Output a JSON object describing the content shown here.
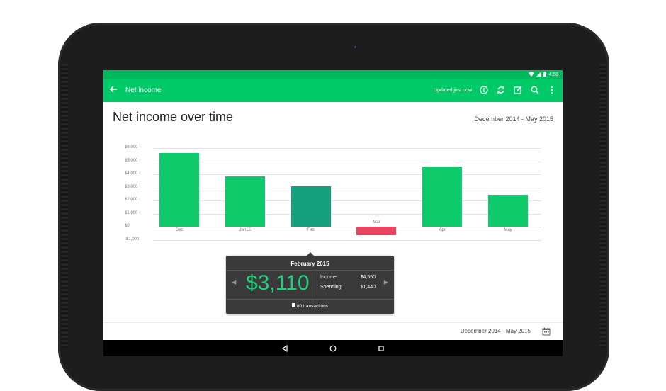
{
  "status_bar": {
    "time": "4:58"
  },
  "toolbar": {
    "title": "Net income",
    "updated_text": "Updated just now",
    "icons": [
      "back-arrow-icon",
      "info-icon",
      "refresh-icon",
      "edit-icon",
      "search-icon",
      "more-vert-icon"
    ]
  },
  "page": {
    "heading": "Net income over time",
    "date_range": "December 2014 - May 2015"
  },
  "chart_data": {
    "type": "bar",
    "categories": [
      "Dec",
      "Jan15",
      "Feb",
      "Mar",
      "Apr",
      "May"
    ],
    "values": [
      5600,
      3850,
      3110,
      -600,
      4550,
      2450
    ],
    "selected": "Feb",
    "y_ticks": [
      "$6,000",
      "$5,000",
      "$4,000",
      "$3,000",
      "$2,000",
      "$1,000",
      "$0",
      "-$1,000"
    ],
    "ylim": [
      -1000,
      6000
    ],
    "colors": {
      "positive": "#0dca6b",
      "negative": "#e94560",
      "selected": "#13a07d"
    },
    "grid": true
  },
  "popup": {
    "month": "February 2015",
    "amount": "$3,110",
    "income_label": "Income:",
    "income_value": "$4,550",
    "spending_label": "Spending:",
    "spending_value": "$1,440",
    "transactions": "80 transactions"
  },
  "footer": {
    "date_range": "December 2014 - May 2015"
  }
}
